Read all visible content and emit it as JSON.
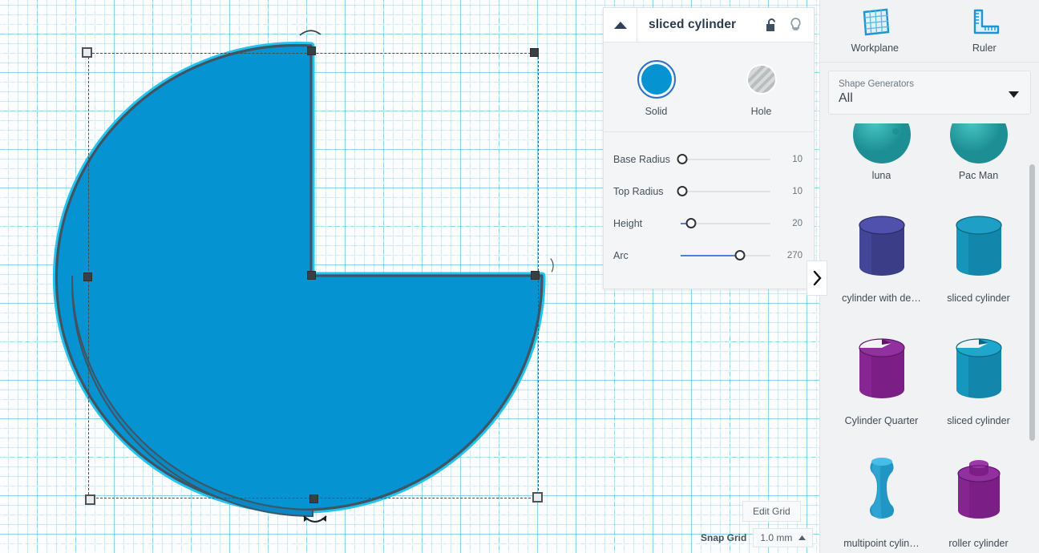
{
  "inspector": {
    "title": "sliced cylinder",
    "collapse_icon": "triangle-up-icon",
    "lock_icon": "unlocked-padlock-icon",
    "light_icon": "lightbulb-icon",
    "modes": [
      {
        "label": "Solid",
        "selected": true,
        "color": "#0693d2"
      },
      {
        "label": "Hole",
        "selected": false,
        "color": "#b9bdbe"
      }
    ],
    "parameters": [
      {
        "label": "Base Radius",
        "value": "10",
        "percent": 2
      },
      {
        "label": "Top Radius",
        "value": "10",
        "percent": 2
      },
      {
        "label": "Height",
        "value": "20",
        "percent": 12
      },
      {
        "label": "Arc",
        "value": "270",
        "percent": 66
      }
    ],
    "expand_tab_icon": "chevron-right-icon"
  },
  "canvas": {
    "shape_name": "sliced cylinder",
    "shape_fill": "#0693d2",
    "shape_outline": "#3f5563",
    "shape_glow": "#22c3f0",
    "grid_line_color": "#5abee1",
    "arc_degrees": 270
  },
  "bottom_bar": {
    "edit_grid_label": "Edit Grid",
    "snap_grid_label": "Snap Grid",
    "snap_grid_value": "1.0 mm",
    "snap_caret_icon": "caret-up-icon"
  },
  "sidebar": {
    "tools": [
      {
        "label": "Workplane",
        "icon": "workplane-icon"
      },
      {
        "label": "Ruler",
        "icon": "ruler-icon"
      }
    ],
    "generators": {
      "caption": "Shape Generators",
      "value": "All",
      "caret_icon": "caret-down-icon"
    },
    "shapes": [
      {
        "name": "luna",
        "color": "#2aa2a4",
        "kind": "sphere"
      },
      {
        "name": "Pac Man",
        "color": "#2aa2a4",
        "kind": "sphere"
      },
      {
        "name": "cylinder with de…",
        "color": "#3b3d87",
        "kind": "cylinder"
      },
      {
        "name": "sliced cylinder",
        "color": "#1287ab",
        "kind": "cylinder"
      },
      {
        "name": "Cylinder Quarter",
        "color": "#7b1f86",
        "kind": "notched-cylinder"
      },
      {
        "name": "sliced cylinder",
        "color": "#1287ab",
        "kind": "notched-cylinder"
      },
      {
        "name": "multipoint cylin…",
        "color": "#2196c4",
        "kind": "spool"
      },
      {
        "name": "roller cylinder",
        "color": "#7b1f86",
        "kind": "roller"
      }
    ]
  }
}
